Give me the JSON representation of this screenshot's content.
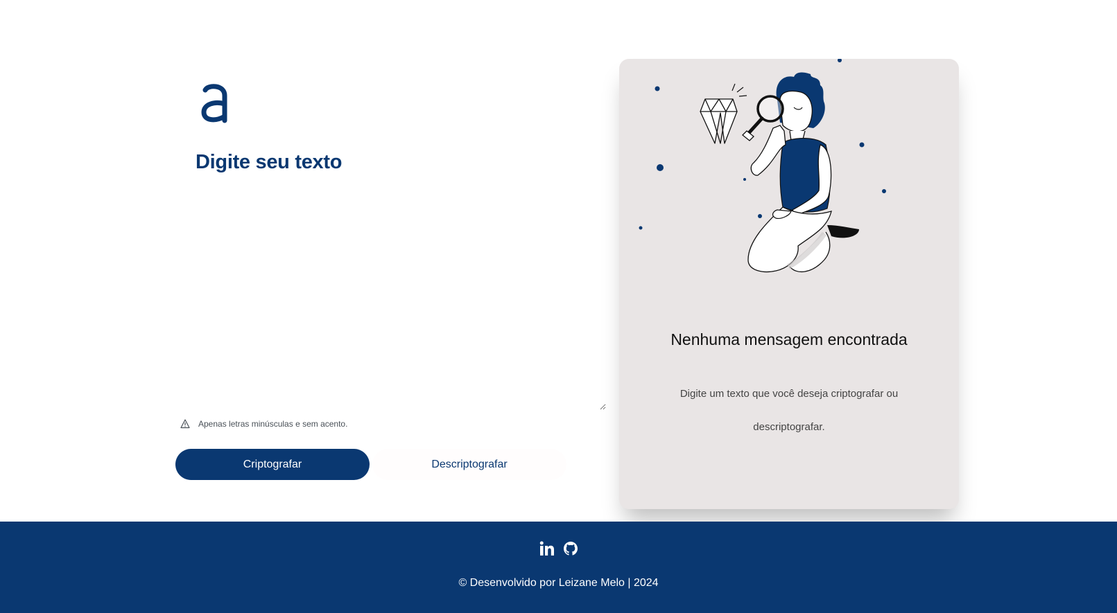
{
  "logo": {
    "letter": "a",
    "color": "#0a3871"
  },
  "input": {
    "title": "Digite seu texto",
    "value": "",
    "hint": "Apenas letras minúsculas e sem acento."
  },
  "actions": {
    "encrypt_label": "Criptografar",
    "decrypt_label": "Descriptografar"
  },
  "output": {
    "title": "Nenhuma mensagem encontrada",
    "message": "Digite um texto que você deseja criptografar ou descriptografar."
  },
  "footer": {
    "social": [
      "linkedin-icon",
      "github-icon"
    ],
    "copyright": "© Desenvolvido por Leizane Melo | 2024"
  },
  "colors": {
    "primary": "#0a3871",
    "panel_bg": "#e9e5e5",
    "footer_bg": "#0a3871"
  }
}
